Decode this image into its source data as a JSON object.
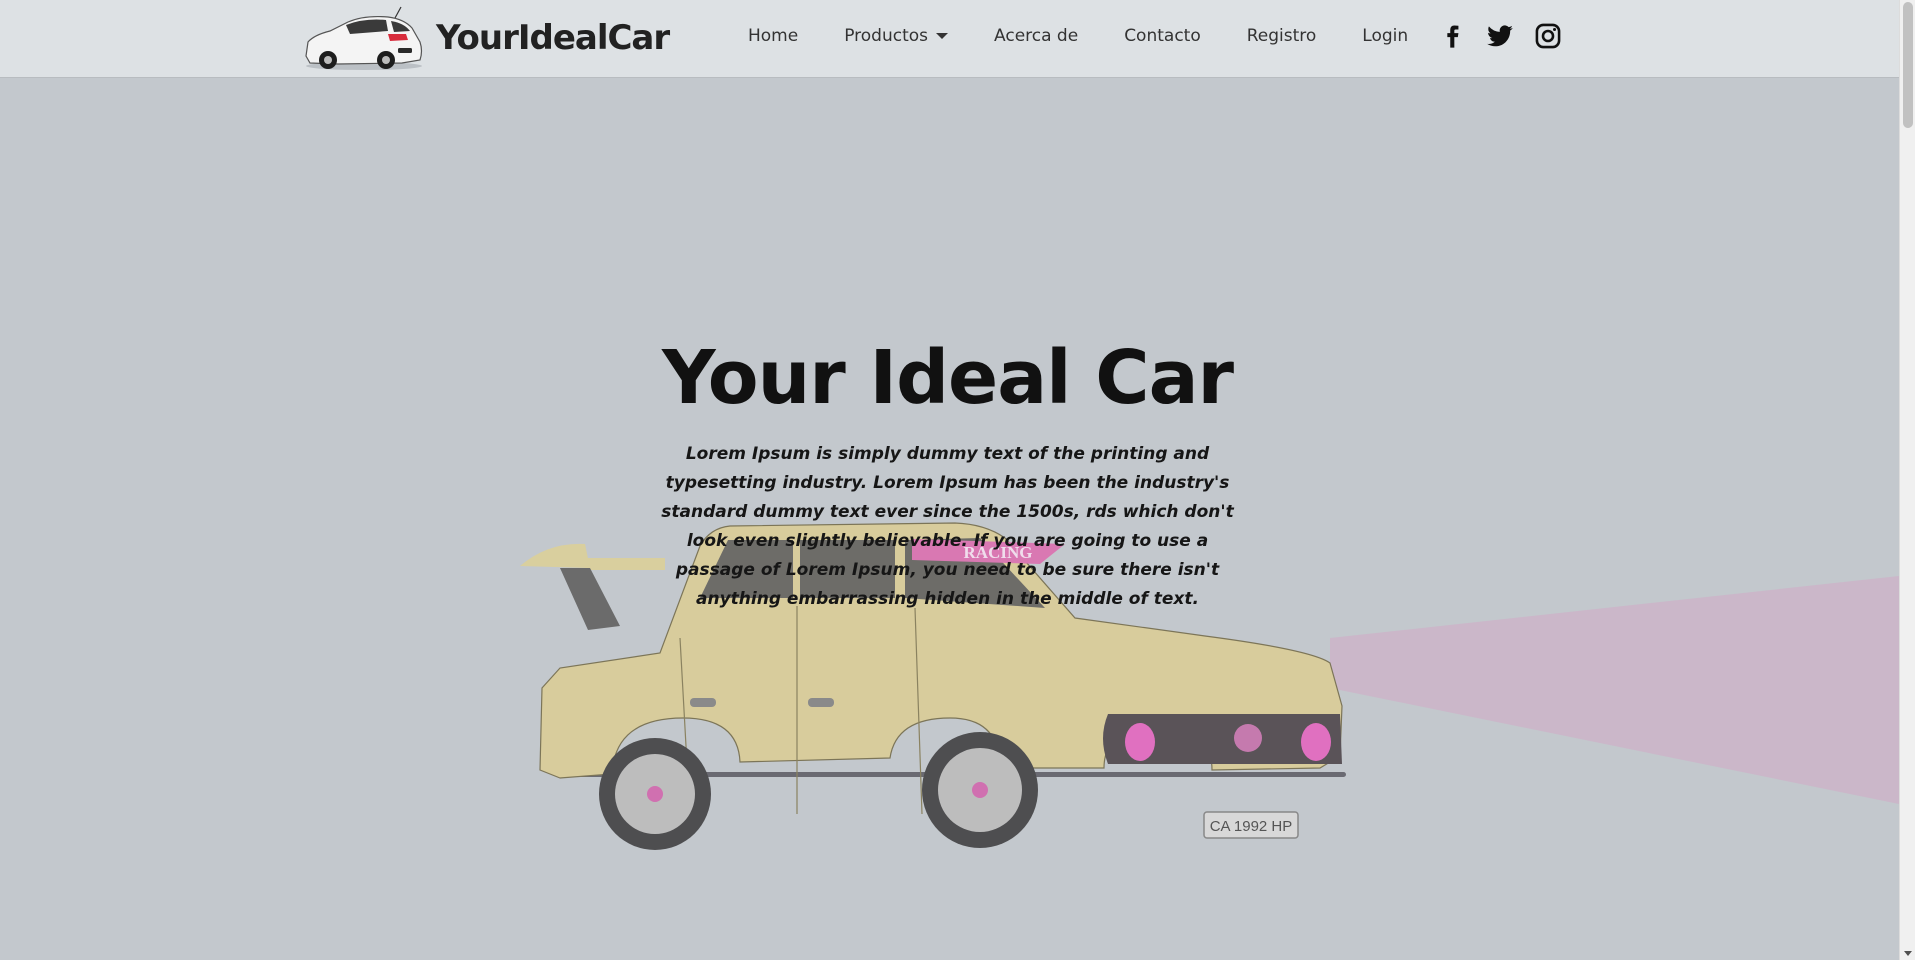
{
  "brand": {
    "name": "YourIdealCar",
    "logo_icon": "white-hatchback-car-icon"
  },
  "nav": {
    "items": [
      {
        "label": "Home"
      },
      {
        "label": "Productos",
        "has_dropdown": true
      },
      {
        "label": "Acerca de"
      },
      {
        "label": "Contacto"
      },
      {
        "label": "Registro"
      },
      {
        "label": "Login"
      }
    ]
  },
  "social": [
    {
      "icon": "facebook-icon"
    },
    {
      "icon": "twitter-icon"
    },
    {
      "icon": "instagram-icon"
    }
  ],
  "hero": {
    "title": "Your Ideal Car",
    "text": "Lorem Ipsum is simply dummy text of the printing and typesetting industry. Lorem Ipsum has been the industry's standard dummy text ever since the 1500s, rds which don't look even slightly believable. If you are going to use a passage of Lorem Ipsum, you need to be sure there isn't anything embarrassing hidden in the middle of text.",
    "car": {
      "windshield_sticker": "RACING",
      "license_plate": "CA 1992 HP"
    }
  },
  "colors": {
    "navbar_bg": "#dde1e4",
    "hero_bg": "#c3c8cd",
    "text_dark": "#111111",
    "car_body": "#d8cc9c",
    "accent_pink": "#e070c0"
  }
}
